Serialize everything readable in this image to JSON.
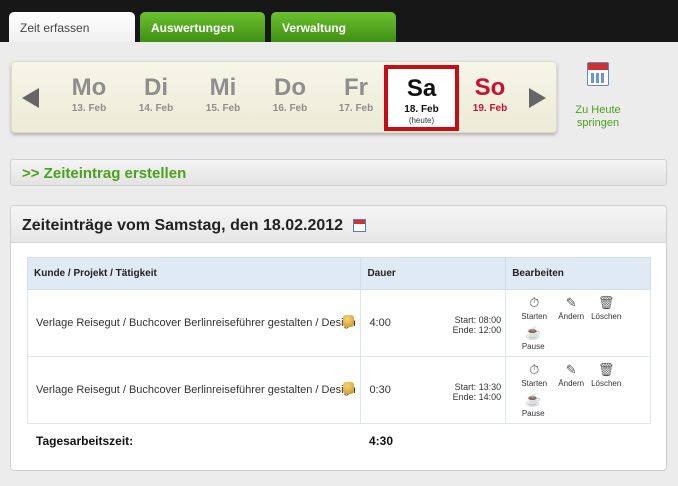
{
  "tabs": [
    {
      "label": "Zeit erfassen"
    },
    {
      "label": "Auswertungen"
    },
    {
      "label": "Verwaltung"
    }
  ],
  "week": {
    "days": [
      {
        "abbr": "Mo",
        "date": "13. Feb"
      },
      {
        "abbr": "Di",
        "date": "14. Feb"
      },
      {
        "abbr": "Mi",
        "date": "15. Feb"
      },
      {
        "abbr": "Do",
        "date": "16. Feb"
      },
      {
        "abbr": "Fr",
        "date": "17. Feb"
      },
      {
        "abbr": "Sa",
        "date": "18. Feb",
        "note": "(heute)"
      },
      {
        "abbr": "So",
        "date": "19. Feb"
      }
    ],
    "today_link": "Zu Heute springen"
  },
  "create_entry": ">> Zeiteintrag erstellen",
  "panel_title": "Zeiteinträge vom Samstag, den 18.02.2012",
  "table": {
    "headers": [
      "Kunde / Projekt / Tätigkeit",
      "Dauer",
      "Bearbeiten"
    ],
    "rows": [
      {
        "task": "Verlage Reisegut / Buchcover Berlinreiseführer gestalten / Design",
        "duration": "4:00",
        "start": "Start: 08:00",
        "end": "Ende: 12:00"
      },
      {
        "task": "Verlage Reisegut / Buchcover Berlinreiseführer gestalten / Design",
        "duration": "0:30",
        "start": "Start: 13:30",
        "end": "Ende: 14:00"
      }
    ],
    "actions": {
      "start": "Starten",
      "edit": "Ändern",
      "delete": "Löschen",
      "pause": "Pause"
    }
  },
  "total": {
    "label": "Tagesarbeitszeit:",
    "value": "4:30"
  },
  "icons": {
    "calendar": "calendar-icon",
    "stopwatch": "stopwatch-icon",
    "pencil": "pencil-icon",
    "trash": "trash-icon",
    "pause": "pause-icon",
    "coins": "coins-icon"
  },
  "colors": {
    "accent_green": "#4aa11a",
    "today_border": "#c60d14",
    "sunday": "#c8102e",
    "header_blue": "#dfeaf5"
  }
}
